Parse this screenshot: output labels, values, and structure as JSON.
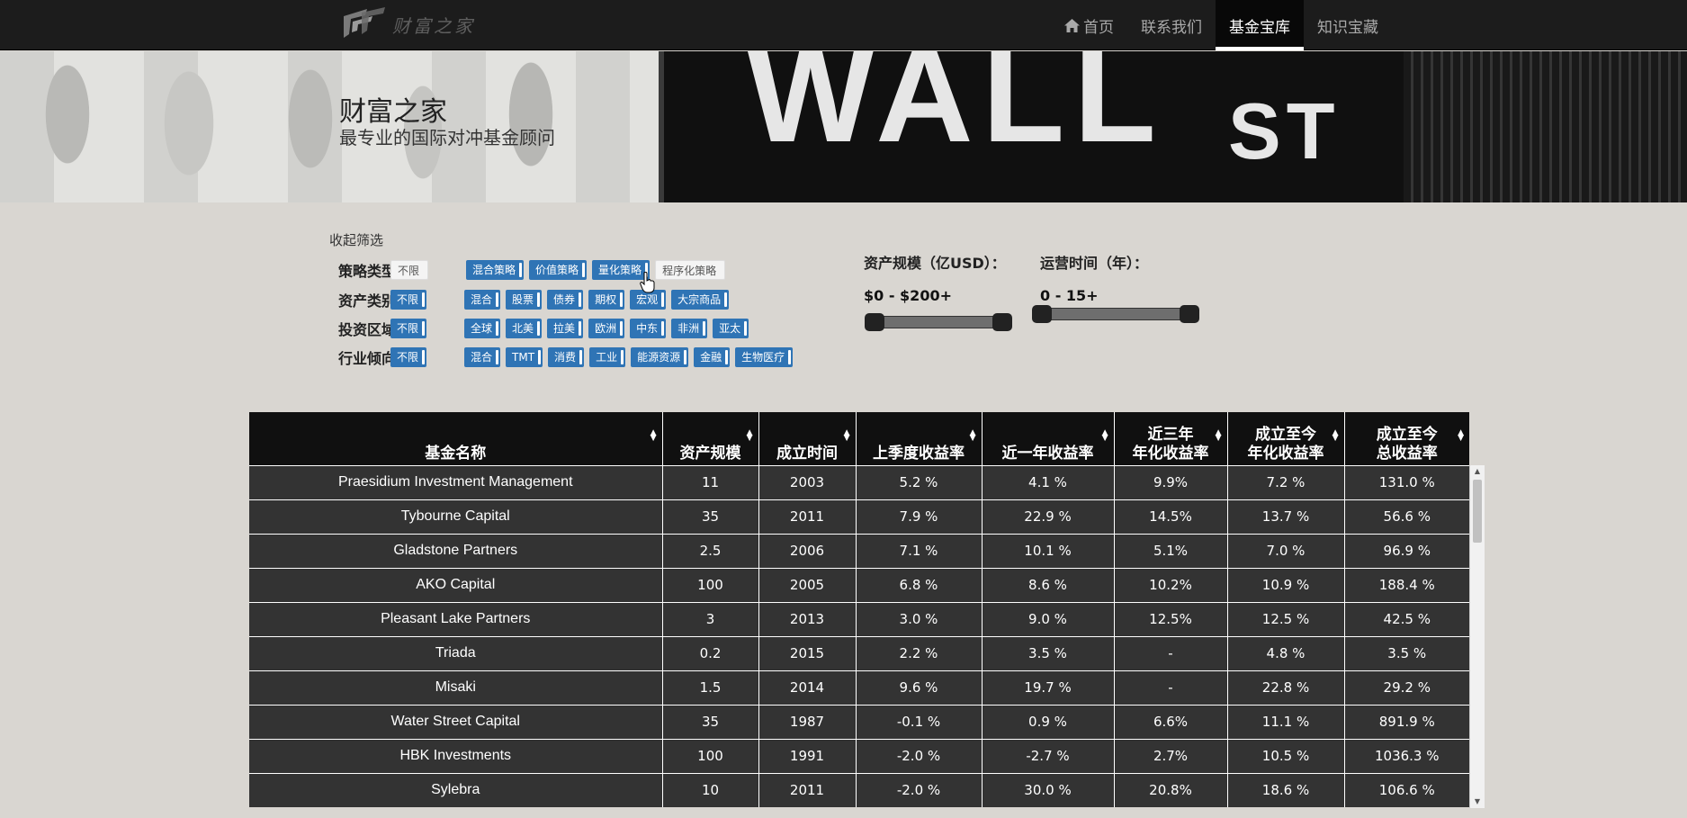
{
  "brand": {
    "name": "财富之家"
  },
  "nav": [
    {
      "label": "首页",
      "icon": "home-icon",
      "active": false
    },
    {
      "label": "联系我们",
      "active": false
    },
    {
      "label": "基金宝库",
      "active": true
    },
    {
      "label": "知识宝藏",
      "active": false
    }
  ],
  "hero": {
    "title": "财富之家",
    "subtitle": "最专业的国际对冲基金顾问",
    "sign_main": "WALL",
    "sign_suffix": "ST"
  },
  "filters": {
    "collapse_label": "收起筛选",
    "rows": [
      {
        "label": "策略类型：",
        "default": "不限",
        "default_selected": false,
        "tags": [
          {
            "label": "混合策略",
            "selected": true
          },
          {
            "label": "价值策略",
            "selected": true
          },
          {
            "label": "量化策略",
            "selected": true
          },
          {
            "label": "程序化策略",
            "selected": false
          }
        ]
      },
      {
        "label": "资产类别：",
        "default": "不限",
        "default_selected": true,
        "tags": [
          {
            "label": "混合",
            "selected": true
          },
          {
            "label": "股票",
            "selected": true
          },
          {
            "label": "债券",
            "selected": true
          },
          {
            "label": "期权",
            "selected": true
          },
          {
            "label": "宏观",
            "selected": true
          },
          {
            "label": "大宗商品",
            "selected": true
          }
        ]
      },
      {
        "label": "投资区域：",
        "default": "不限",
        "default_selected": true,
        "tags": [
          {
            "label": "全球",
            "selected": true
          },
          {
            "label": "北美",
            "selected": true
          },
          {
            "label": "拉美",
            "selected": true
          },
          {
            "label": "欧洲",
            "selected": true
          },
          {
            "label": "中东",
            "selected": true
          },
          {
            "label": "非洲",
            "selected": true
          },
          {
            "label": "亚太",
            "selected": true
          }
        ]
      },
      {
        "label": "行业倾向：",
        "default": "不限",
        "default_selected": true,
        "tags": [
          {
            "label": "混合",
            "selected": true
          },
          {
            "label": "TMT",
            "selected": true
          },
          {
            "label": "消费",
            "selected": true
          },
          {
            "label": "工业",
            "selected": true
          },
          {
            "label": "能源资源",
            "selected": true
          },
          {
            "label": "金融",
            "selected": true
          },
          {
            "label": "生物医疗",
            "selected": true
          }
        ]
      }
    ],
    "asset_range": {
      "title": "资产规模（亿USD）：",
      "value": "$0 - $200+"
    },
    "years_range": {
      "title": "运营时间（年）：",
      "value": "0 - 15+"
    }
  },
  "table": {
    "headers": [
      [
        "基金名称"
      ],
      [
        "资产规模"
      ],
      [
        "成立时间"
      ],
      [
        "上季度收益率"
      ],
      [
        "近一年收益率"
      ],
      [
        "近三年",
        "年化收益率"
      ],
      [
        "成立至今",
        "年化收益率"
      ],
      [
        "成立至今",
        "总收益率"
      ]
    ],
    "rows": [
      [
        "Praesidium Investment Management",
        "11",
        "2003",
        "5.2 %",
        "4.1 %",
        "9.9%",
        "7.2 %",
        "131.0 %"
      ],
      [
        "Tybourne Capital",
        "35",
        "2011",
        "7.9 %",
        "22.9 %",
        "14.5%",
        "13.7 %",
        "56.6 %"
      ],
      [
        "Gladstone Partners",
        "2.5",
        "2006",
        "7.1 %",
        "10.1 %",
        "5.1%",
        "7.0 %",
        "96.9 %"
      ],
      [
        "AKO Capital",
        "100",
        "2005",
        "6.8 %",
        "8.6 %",
        "10.2%",
        "10.9 %",
        "188.4 %"
      ],
      [
        "Pleasant Lake Partners",
        "3",
        "2013",
        "3.0 %",
        "9.0 %",
        "12.5%",
        "12.5 %",
        "42.5 %"
      ],
      [
        "Triada",
        "0.2",
        "2015",
        "2.2 %",
        "3.5 %",
        "-",
        "4.8 %",
        "3.5 %"
      ],
      [
        "Misaki",
        "1.5",
        "2014",
        "9.6 %",
        "19.7 %",
        "-",
        "22.8 %",
        "29.2 %"
      ],
      [
        "Water Street Capital",
        "35",
        "1987",
        "-0.1 %",
        "0.9 %",
        "6.6%",
        "11.1 %",
        "891.9 %"
      ],
      [
        "HBK Investments",
        "100",
        "1991",
        "-2.0 %",
        "-2.7 %",
        "2.7%",
        "10.5 %",
        "1036.3 %"
      ],
      [
        "Sylebra",
        "10",
        "2011",
        "-2.0 %",
        "30.0 %",
        "20.8%",
        "18.6 %",
        "106.6 %"
      ]
    ]
  },
  "colors": {
    "tag_blue": "#2f74b5",
    "navbar": "#1c1c1c",
    "table_row": "#333333",
    "page_bg": "#d9d6d1"
  }
}
